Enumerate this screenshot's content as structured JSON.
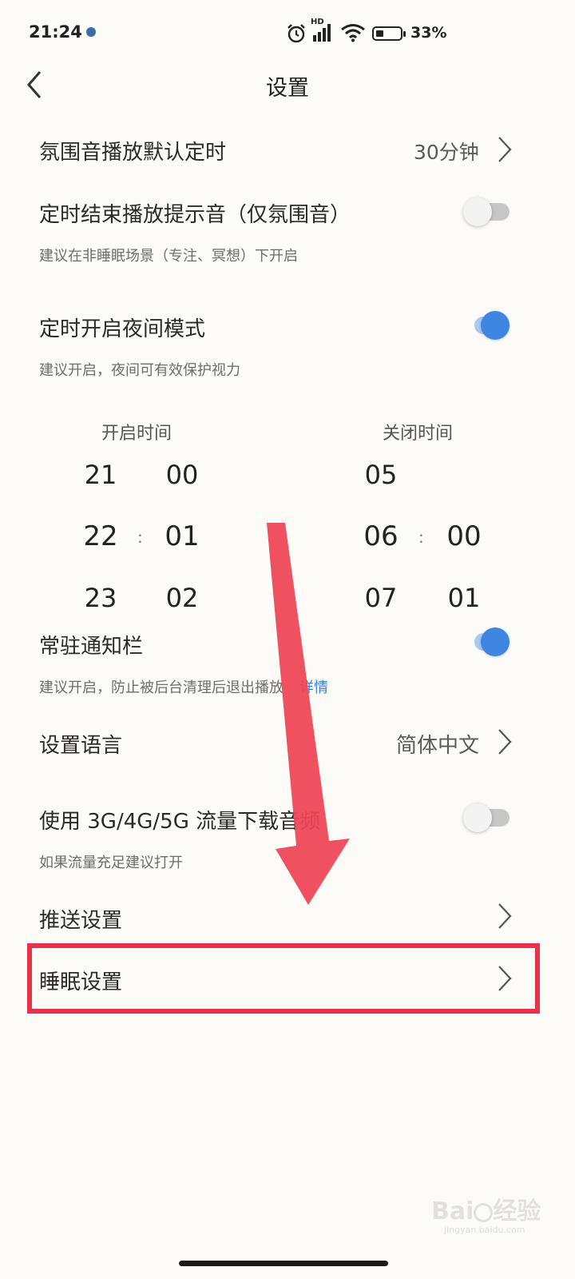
{
  "status_bar": {
    "time": "21:24",
    "network_label": "HD",
    "battery_level": 0.33,
    "battery_text": "33%"
  },
  "header": {
    "title": "设置"
  },
  "settings": {
    "ambience_timer": {
      "label": "氛围音播放默认定时",
      "value": "30分钟"
    },
    "timer_end_sound": {
      "label": "定时结束播放提示音（仅氛围音）",
      "desc": "建议在非睡眠场景（专注、冥想）下开启",
      "enabled": false
    },
    "night_mode": {
      "label": "定时开启夜间模式",
      "desc": "建议开启，夜间可有效保护视力",
      "enabled": true
    },
    "time_picker": {
      "start_label": "开启时间",
      "end_label": "关闭时间",
      "start_hours": [
        "21",
        "22",
        "23"
      ],
      "start_minutes": [
        "00",
        "01",
        "02"
      ],
      "end_hours": [
        "05",
        "06",
        "07"
      ],
      "end_minutes": [
        "",
        "00",
        "01"
      ],
      "separator": ":"
    },
    "notification": {
      "label": "常驻通知栏",
      "desc": "建议开启，防止被后台清理后退出播放",
      "link": "详情",
      "enabled": true
    },
    "language": {
      "label": "设置语言",
      "value": "简体中文"
    },
    "mobile_data": {
      "label": "使用 3G/4G/5G 流量下载音频",
      "desc": "如果流量充足建议打开",
      "enabled": false
    },
    "push": {
      "label": "推送设置"
    },
    "sleep": {
      "label": "睡眠设置"
    }
  },
  "annotation_colors": {
    "highlight": "#e8324b",
    "arrow": "#ef4455"
  },
  "watermark": {
    "text": "Baidu经验",
    "subtext": "jingyan.baidu.com"
  }
}
